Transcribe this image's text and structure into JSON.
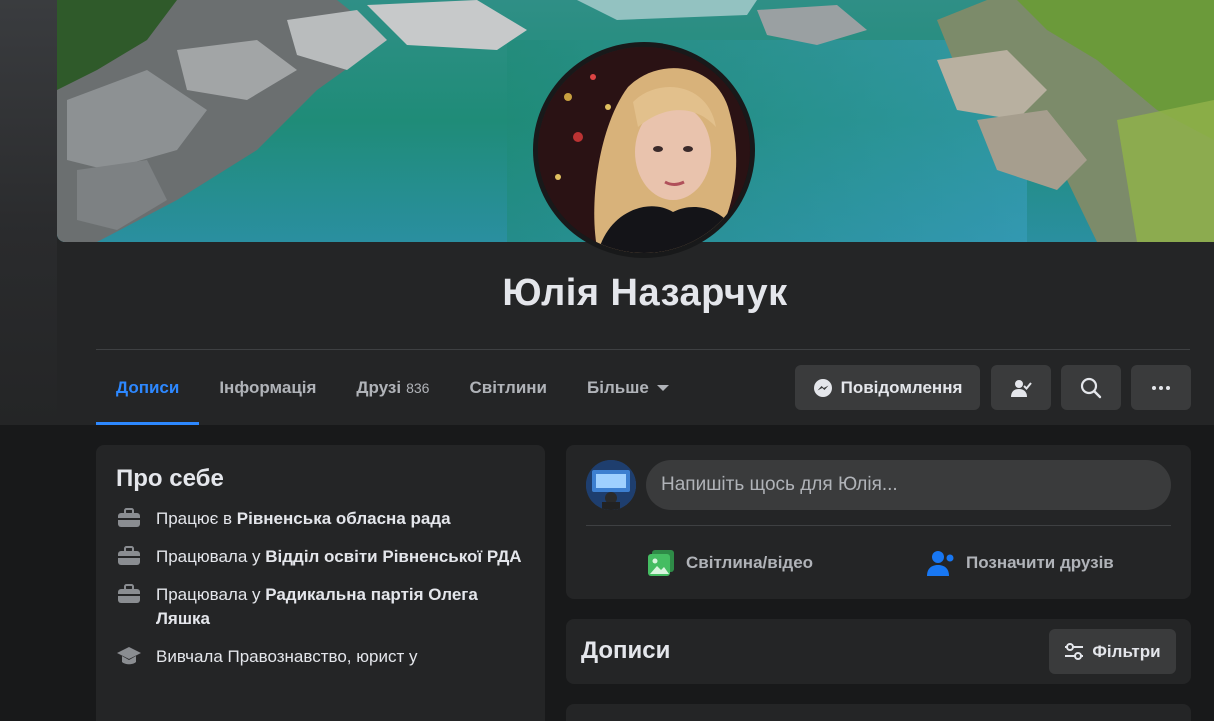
{
  "profile": {
    "name": "Юлія Назарчук"
  },
  "tabs": [
    {
      "label": "Дописи"
    },
    {
      "label": "Інформація"
    },
    {
      "label": "Друзі",
      "count": "836"
    },
    {
      "label": "Світлини"
    },
    {
      "label": "Більше"
    }
  ],
  "actions": {
    "message_label": "Повідомлення"
  },
  "about": {
    "title": "Про себе",
    "items": [
      {
        "prefix": "Працює в ",
        "bold": "Рівненська обласна рада",
        "icon": "briefcase-icon"
      },
      {
        "prefix": "Працювала у ",
        "bold": "Відділ освіти Рівненської РДА",
        "icon": "briefcase-icon"
      },
      {
        "prefix": "Працювала у ",
        "bold": "Радикальна партія Олега Ляшка",
        "icon": "briefcase-icon"
      },
      {
        "prefix": "Вивчала Правознавство, юрист у",
        "bold": "",
        "icon": "graduation-cap-icon"
      }
    ]
  },
  "composer": {
    "placeholder": "Напишіть щось для Юлія...",
    "photo_label": "Світлина/відео",
    "tag_label": "Позначити друзів"
  },
  "posts": {
    "title": "Дописи",
    "filters_label": "Фільтри"
  },
  "colors": {
    "accent": "#2d88ff",
    "background": "#18191a",
    "card": "#242526",
    "button": "#3a3b3c",
    "photo_green": "#45bd62",
    "tag_blue": "#1877f2"
  }
}
